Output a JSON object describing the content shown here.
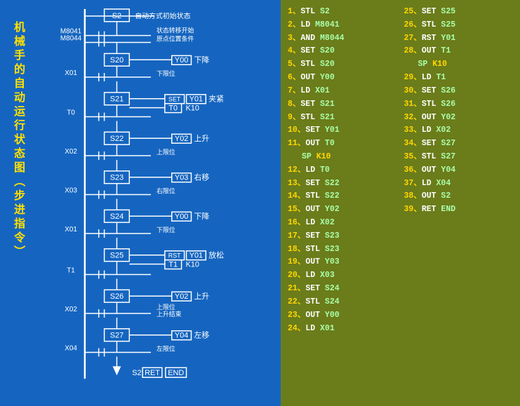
{
  "leftPanel": {
    "title": "机械手的自动运行状态图（步进指令）",
    "bgColor": "#1565C0"
  },
  "rightPanel": {
    "bgColor": "#6B7C1A",
    "col1": [
      {
        "num": "1、",
        "cmd": "STL",
        "op": "S2"
      },
      {
        "num": "2、",
        "cmd": "LD",
        "op": "M8041"
      },
      {
        "num": "3、",
        "cmd": "AND",
        "op": "M8044"
      },
      {
        "num": "4、",
        "cmd": "SET",
        "op": "S20"
      },
      {
        "num": "5、",
        "cmd": "STL",
        "op": "S20"
      },
      {
        "num": "6、",
        "cmd": "OUT",
        "op": "Y00"
      },
      {
        "num": "7、",
        "cmd": "LD",
        "op": "X01"
      },
      {
        "num": "8、",
        "cmd": "SET",
        "op": "S21"
      },
      {
        "num": "9、",
        "cmd": "STL",
        "op": "S21"
      },
      {
        "num": "10、",
        "cmd": "SET",
        "op": "Y01"
      },
      {
        "num": "11、",
        "cmd": "OUT",
        "op": "T0"
      },
      {
        "num": "",
        "cmd": "SP",
        "op": "K10"
      },
      {
        "num": "12、",
        "cmd": "LD",
        "op": "T0"
      },
      {
        "num": "13、",
        "cmd": "SET",
        "op": "S22"
      },
      {
        "num": "14、",
        "cmd": "STL",
        "op": "S22"
      },
      {
        "num": "15、",
        "cmd": "OUT",
        "op": "Y02"
      },
      {
        "num": "16、",
        "cmd": "LD",
        "op": "X02"
      },
      {
        "num": "17、",
        "cmd": "SET",
        "op": "S23"
      },
      {
        "num": "18、",
        "cmd": "STL",
        "op": "S23"
      },
      {
        "num": "19、",
        "cmd": "OUT",
        "op": "Y03"
      },
      {
        "num": "20、",
        "cmd": "LD",
        "op": "X03"
      },
      {
        "num": "21、",
        "cmd": "SET",
        "op": "S24"
      },
      {
        "num": "22、",
        "cmd": "STL",
        "op": "S24"
      },
      {
        "num": "23、",
        "cmd": "OUT",
        "op": "Y00"
      },
      {
        "num": "24、",
        "cmd": "LD",
        "op": "X01"
      }
    ],
    "col2": [
      {
        "num": "25、",
        "cmd": "SET",
        "op": "S25"
      },
      {
        "num": "26、",
        "cmd": "STL",
        "op": "S25"
      },
      {
        "num": "27、",
        "cmd": "RST",
        "op": "Y01"
      },
      {
        "num": "28、",
        "cmd": "OUT",
        "op": "T1"
      },
      {
        "num": "",
        "cmd": "SP",
        "op": "K10"
      },
      {
        "num": "29、",
        "cmd": "LD",
        "op": "T1"
      },
      {
        "num": "30、",
        "cmd": "SET",
        "op": "S26"
      },
      {
        "num": "31、",
        "cmd": "STL",
        "op": "S26"
      },
      {
        "num": "32、",
        "cmd": "OUT",
        "op": "Y02"
      },
      {
        "num": "33、",
        "cmd": "LD",
        "op": "X02"
      },
      {
        "num": "34、",
        "cmd": "SET",
        "op": "S27"
      },
      {
        "num": "35、",
        "cmd": "STL",
        "op": "S27"
      },
      {
        "num": "36、",
        "cmd": "OUT",
        "op": "Y04"
      },
      {
        "num": "37、",
        "cmd": "LD",
        "op": "X04"
      },
      {
        "num": "38、",
        "cmd": "OUT",
        "op": "S2"
      },
      {
        "num": "39、",
        "cmd": "RET",
        "op": "END"
      }
    ]
  }
}
